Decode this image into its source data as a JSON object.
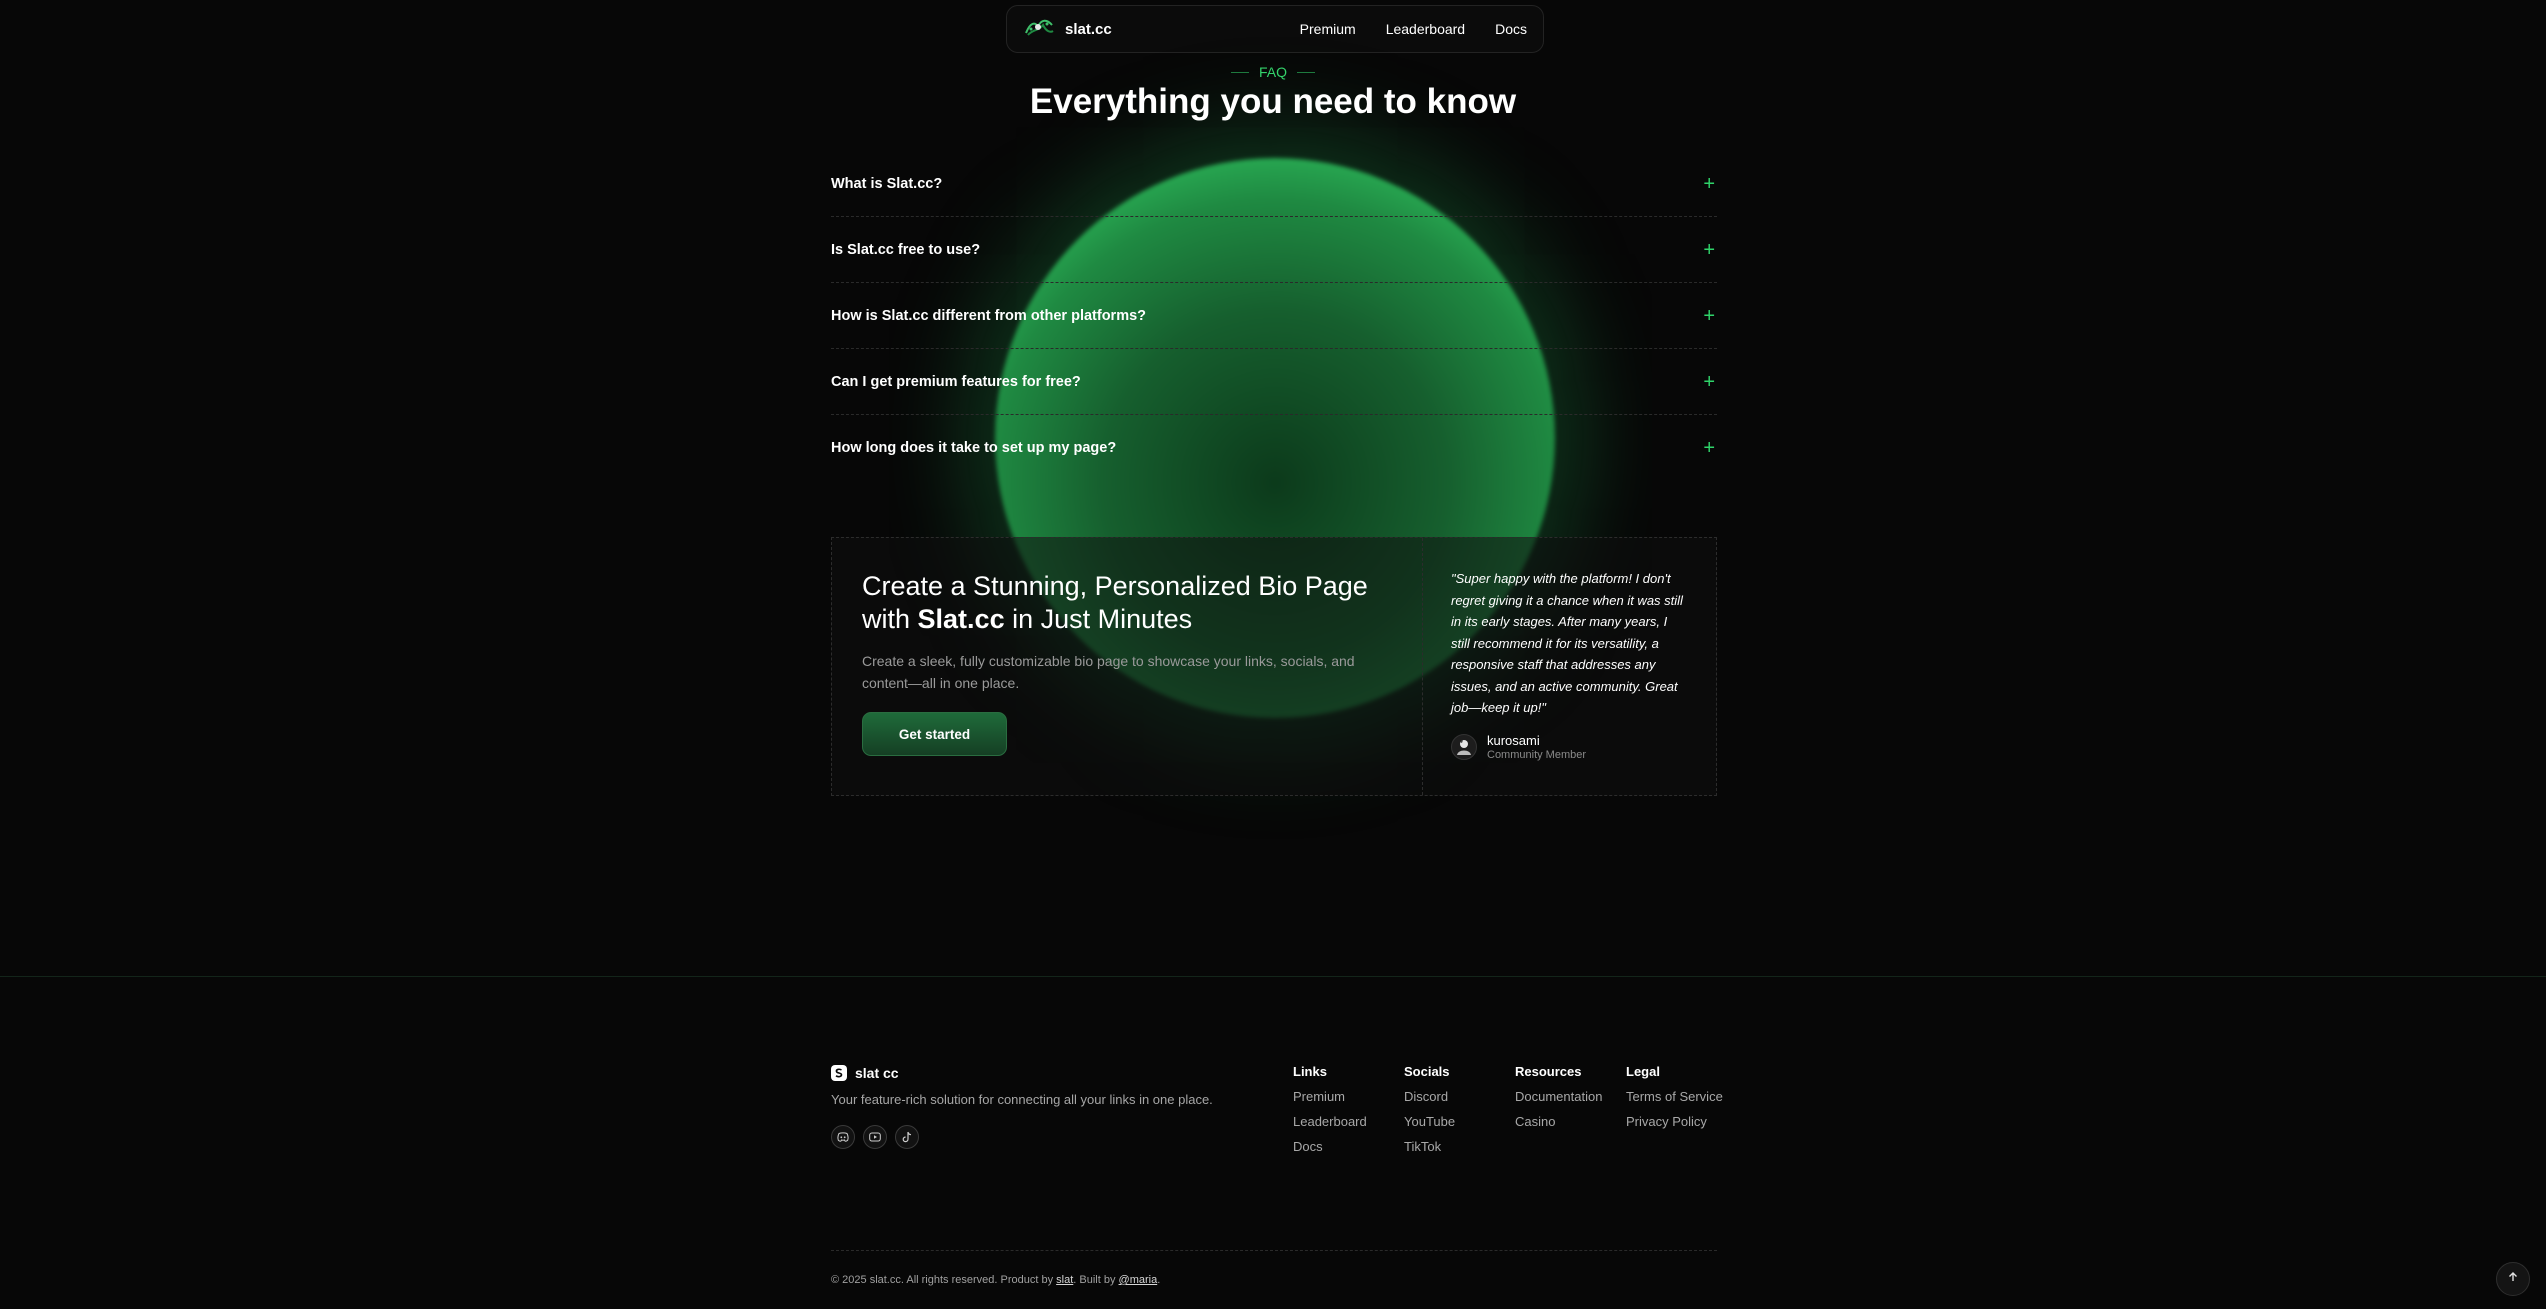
{
  "nav": {
    "brand": "slat.cc",
    "links": [
      "Premium",
      "Leaderboard",
      "Docs"
    ]
  },
  "faq": {
    "tag": "FAQ",
    "title": "Everything you need to know",
    "items": [
      "What is Slat.cc?",
      "Is Slat.cc free to use?",
      "How is Slat.cc different from other platforms?",
      "Can I get premium features for free?",
      "How long does it take to set up my page?"
    ],
    "expand_icon": "plus-icon"
  },
  "cta": {
    "title_part1": "Create a Stunning, Personalized Bio Page with ",
    "title_brand": "Slat.cc",
    "title_part2": " in Just Minutes",
    "description": "Create a sleek, fully customizable bio page to showcase your links, socials, and content—all in one place.",
    "button": "Get started"
  },
  "testimonial": {
    "quote": "\"Super happy with the platform! I don't regret giving it a chance when it was still in its early stages. After many years, I still recommend it for its versatility, a responsive staff that addresses any issues, and an active community. Great job—keep it up!\"",
    "author": "kurosami",
    "role": "Community Member"
  },
  "footer": {
    "brand": "slat cc",
    "tagline": "Your feature-rich solution for connecting all your links in one place.",
    "socials": [
      "discord-icon",
      "youtube-icon",
      "tiktok-icon"
    ],
    "columns": [
      {
        "title": "Links",
        "items": [
          "Premium",
          "Leaderboard",
          "Docs"
        ]
      },
      {
        "title": "Socials",
        "items": [
          "Discord",
          "YouTube",
          "TikTok"
        ]
      },
      {
        "title": "Resources",
        "items": [
          "Documentation",
          "Casino"
        ]
      },
      {
        "title": "Legal",
        "items": [
          "Terms of Service",
          "Privacy Policy"
        ]
      }
    ],
    "copyright_prefix": "© 2025 slat.cc. All rights reserved. Product by ",
    "product_link": "slat",
    "built_by_text": ". Built by ",
    "built_by_link": "@maria",
    "copyright_suffix": "."
  },
  "colors": {
    "accent": "#34d36b",
    "background": "#070707",
    "glow": "#2bb257"
  }
}
